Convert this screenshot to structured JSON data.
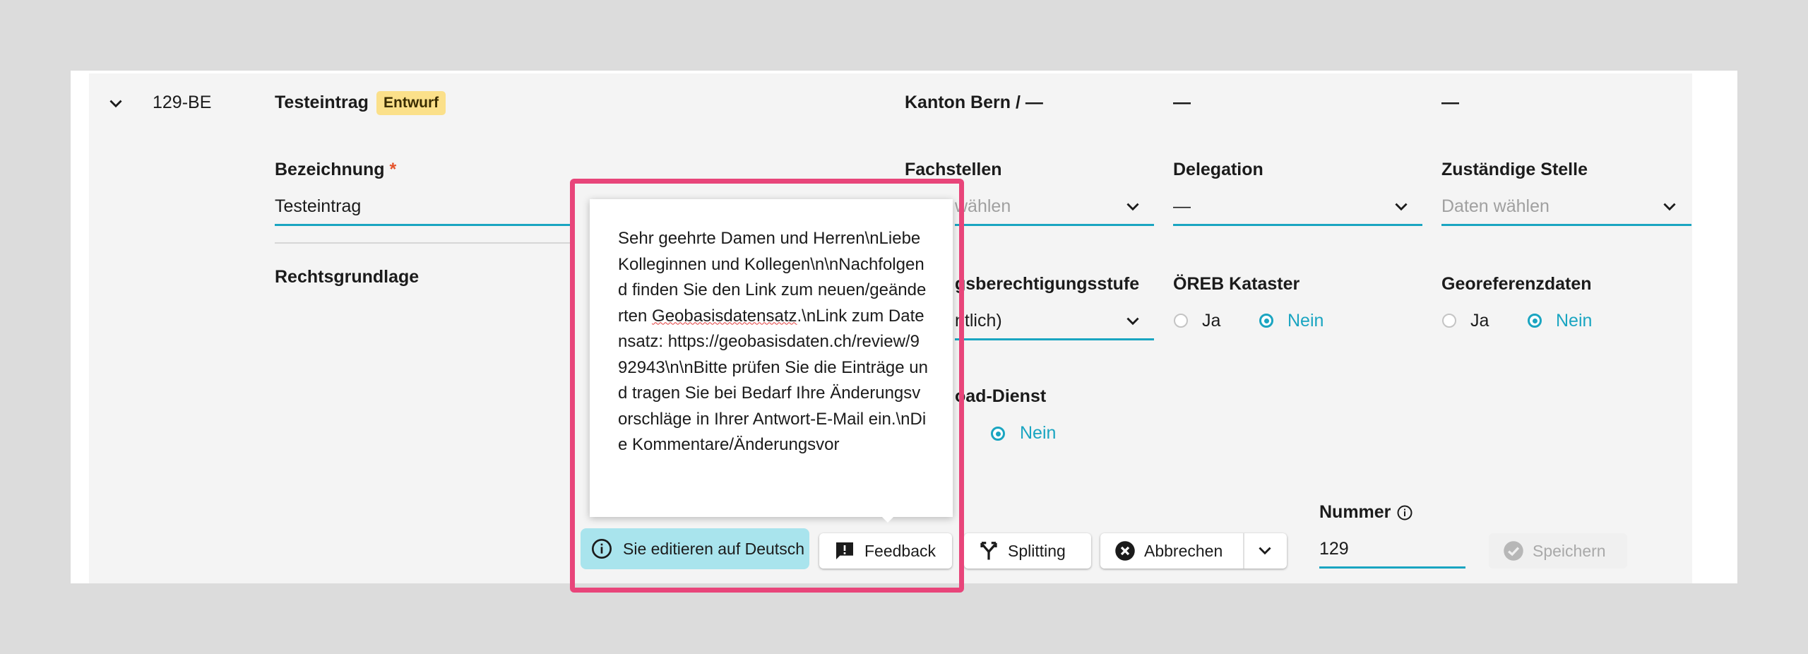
{
  "header": {
    "id": "129-BE",
    "title": "Testeintrag",
    "badge": "Entwurf",
    "canton": "Kanton Bern / —",
    "col2": "—",
    "col3": "—"
  },
  "form": {
    "bezeichnung_label": "Bezeichnung",
    "required_mark": "*",
    "bezeichnung_value": "Testeintrag",
    "rechtsgrundlage_label": "Rechtsgrundlage",
    "fachstellen_label": "Fachstellen",
    "fachstellen_placeholder": "wählen",
    "delegation_label": "Delegation",
    "delegation_value": "—",
    "zustaendige_label": "Zuständige Stelle",
    "zustaendige_placeholder": "Daten wählen",
    "zugang_label": "gsberechtigungsstufe",
    "zugang_value": "ntlich)",
    "oereb_label": "ÖREB Kataster",
    "oereb_ja": "Ja",
    "oereb_nein": "Nein",
    "georef_label": "Georeferenzdaten",
    "georef_ja": "Ja",
    "georef_nein": "Nein",
    "download_label": "oad-Dienst",
    "download_nein": "Nein",
    "nummer_label": "Nummer",
    "nummer_value": "129"
  },
  "popup": {
    "text_before": "Sehr geehrte Damen und Herren\\nLiebe Kolleginnen und Kollegen\\n\\nNachfolgend finden Sie den Link zum neuen/geänderten ",
    "spell_word": "Geobasisdatensatz",
    "text_after": ".\\nLink zum Datensatz: https://geobasisdaten.ch/review/992943\\n\\nBitte prüfen Sie die Einträge und tragen Sie bei Bedarf Ihre Änderungsvorschläge in Ihrer Antwort-E-Mail ein.\\nDie Kommentare/Änderungsvor"
  },
  "toolbar": {
    "info_text": "Sie editieren auf Deutsch",
    "feedback_label": "Feedback",
    "splitting_label": "Splitting",
    "abbrechen_label": "Abbrechen",
    "speichern_label": "Speichern"
  },
  "colors": {
    "accent": "#1aa5c1",
    "highlight": "#e8457a",
    "badge": "#fbe08a",
    "info_bg": "#a9e4ed"
  }
}
